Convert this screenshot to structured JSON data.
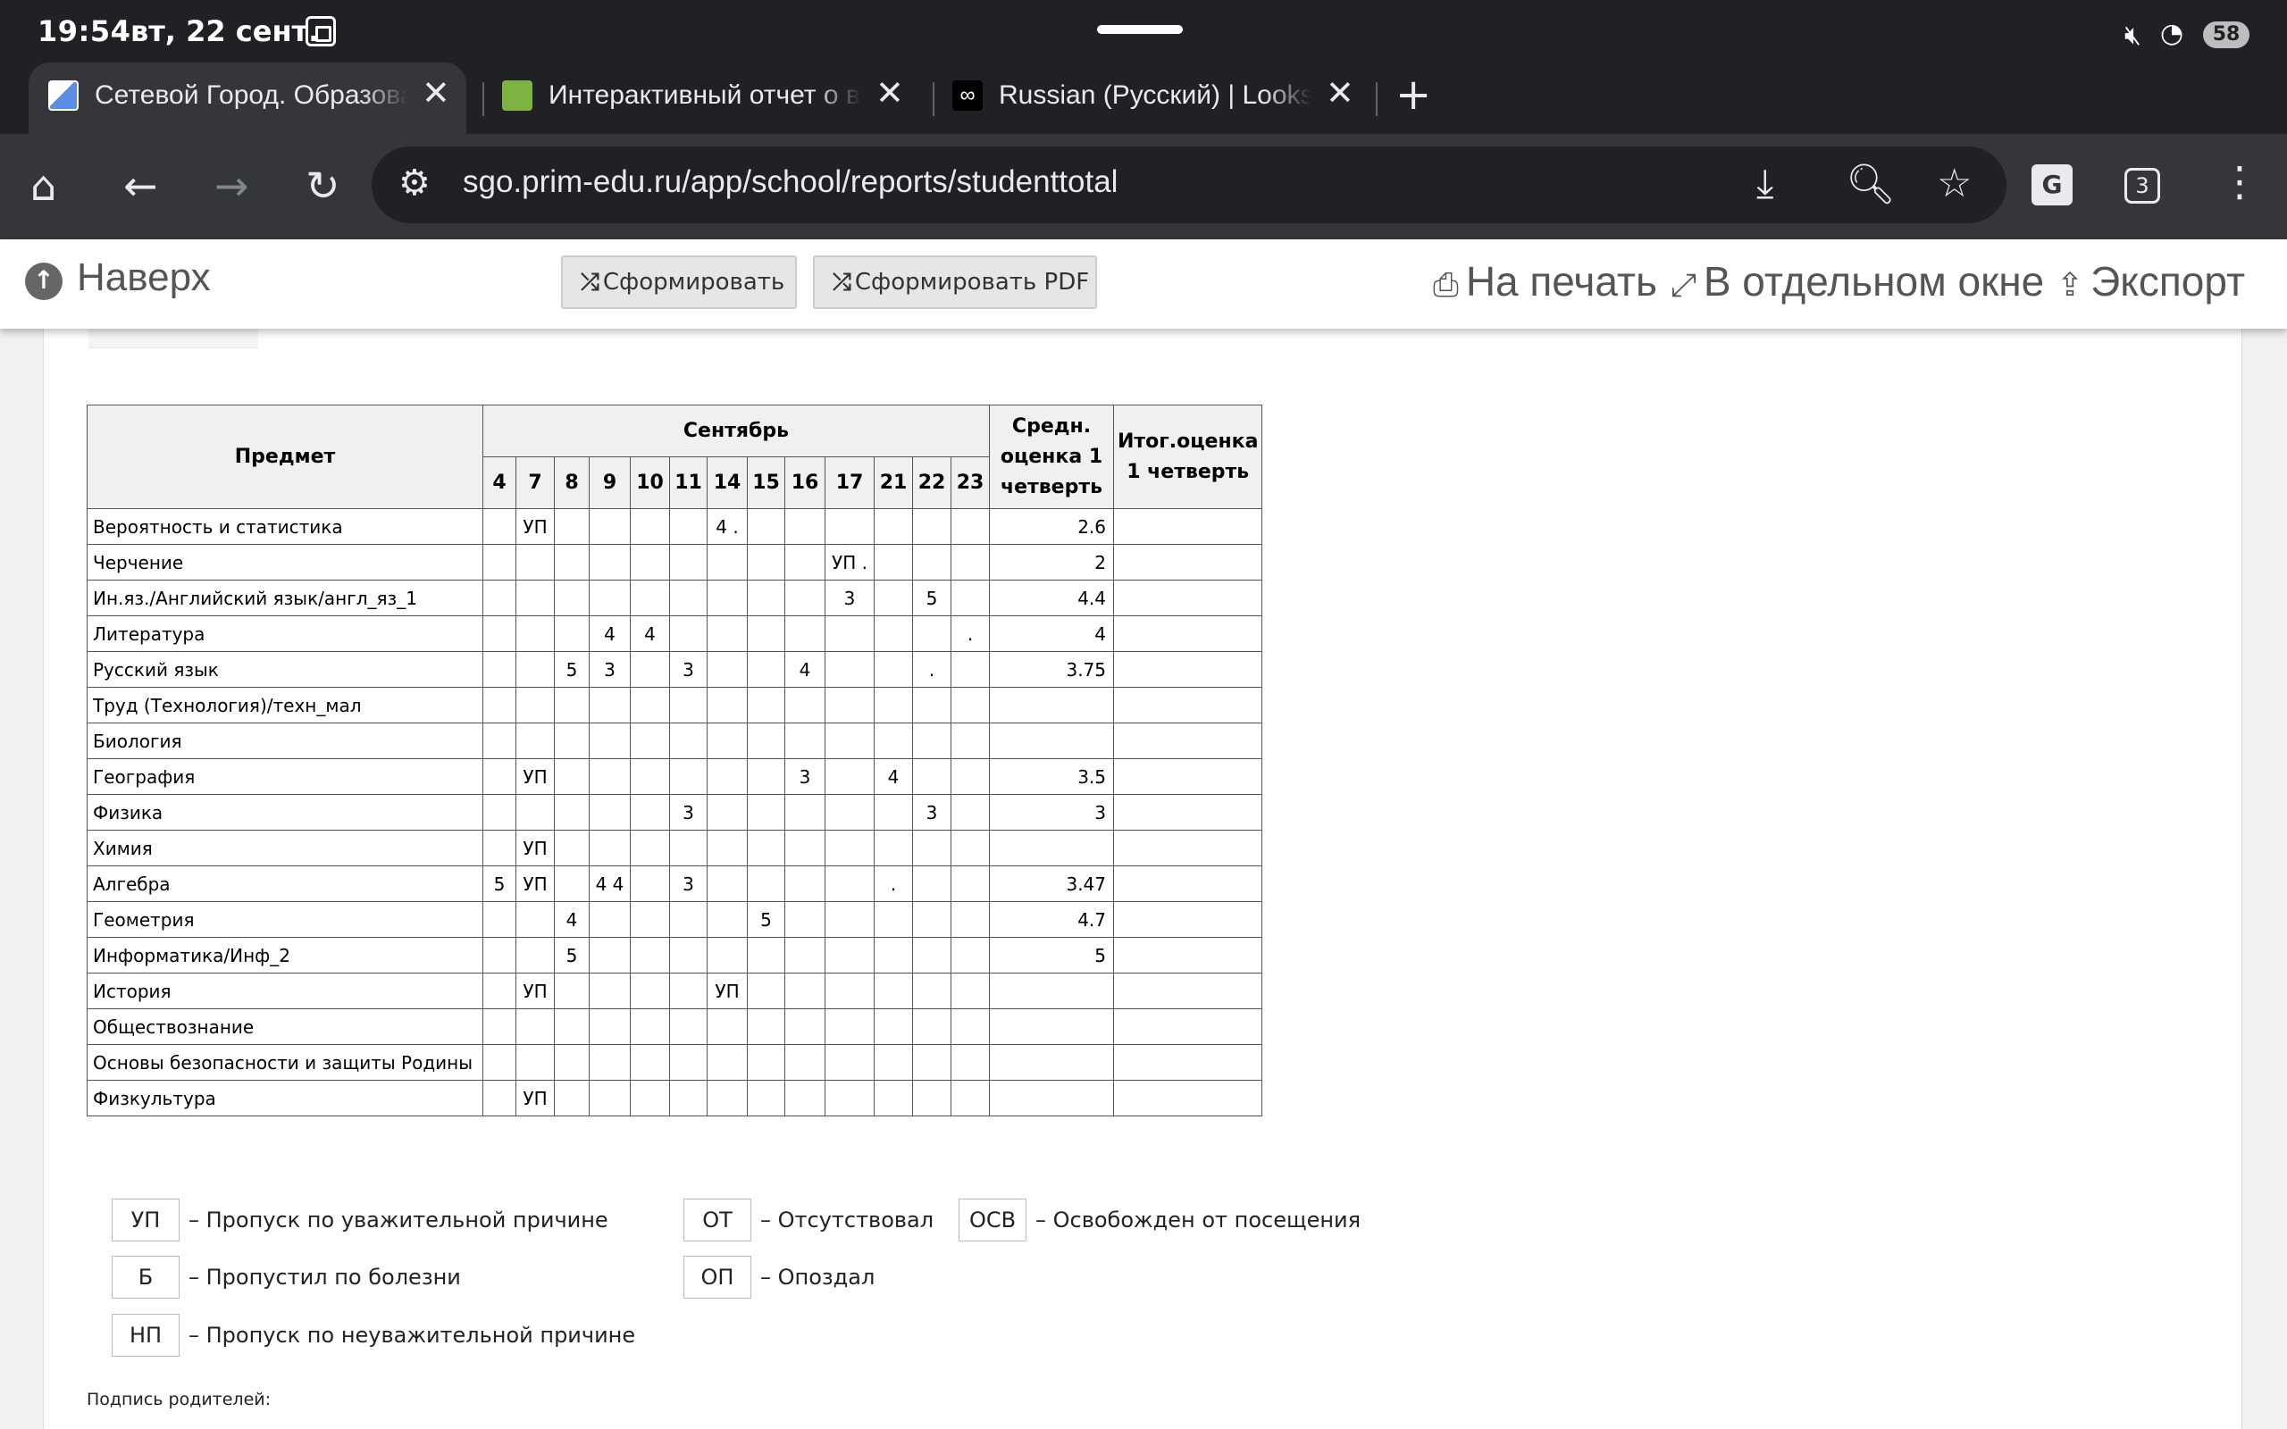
{
  "status": {
    "time": "19:54",
    "date": "вт, 22 сент.",
    "battery": "58"
  },
  "tabs": [
    {
      "title": "Сетевой Город. Образование",
      "fav": "#5a8ee6"
    },
    {
      "title": "Интерактивный отчет о выполнении",
      "fav": "#7cb342"
    },
    {
      "title": "Russian (Русский) | Looksmaxxing",
      "fav": "#000000"
    }
  ],
  "url": "sgo.prim-edu.ru/app/school/reports/studenttotal",
  "tab_count": "3",
  "pagebar": {
    "up_label": "Наверх",
    "btn_generate": "Сформировать",
    "btn_generate_pdf": "Сформировать PDF",
    "print": "На печать",
    "separate_window": "В отдельном окне",
    "export": "Экспорт"
  },
  "table": {
    "subject_header": "Предмет",
    "month": "Сентябрь",
    "days": [
      "4",
      "7",
      "8",
      "9",
      "10",
      "11",
      "14",
      "15",
      "16",
      "17",
      "21",
      "22",
      "23"
    ],
    "avg_header": "Средн. оценка 1 четверть",
    "final_header": "Итог.оценка 1 четверть",
    "rows": [
      {
        "subject": "Вероятность и статистика",
        "cells": [
          "",
          "УП",
          "",
          "",
          "",
          "",
          "4 .",
          "",
          "",
          "",
          "",
          "",
          ""
        ],
        "avg": "2.6",
        "final": ""
      },
      {
        "subject": "Черчение",
        "cells": [
          "",
          "",
          "",
          "",
          "",
          "",
          "",
          "",
          "",
          "УП .",
          "",
          "",
          ""
        ],
        "avg": "2",
        "final": ""
      },
      {
        "subject": "Ин.яз./Английский язык/англ_яз_1",
        "cells": [
          "",
          "",
          "",
          "",
          "",
          "",
          "",
          "",
          "",
          "3",
          "",
          "5",
          ""
        ],
        "avg": "4.4",
        "final": ""
      },
      {
        "subject": "Литература",
        "cells": [
          "",
          "",
          "",
          "4",
          "4",
          "",
          "",
          "",
          "",
          "",
          "",
          "",
          "."
        ],
        "avg": "4",
        "final": ""
      },
      {
        "subject": "Русский язык",
        "cells": [
          "",
          "",
          "5",
          "3",
          "",
          "3",
          "",
          "",
          "4",
          "",
          "",
          ".",
          ""
        ],
        "avg": "3.75",
        "final": ""
      },
      {
        "subject": "Труд (Технология)/техн_мал",
        "cells": [
          "",
          "",
          "",
          "",
          "",
          "",
          "",
          "",
          "",
          "",
          "",
          "",
          ""
        ],
        "avg": "",
        "final": ""
      },
      {
        "subject": "Биология",
        "cells": [
          "",
          "",
          "",
          "",
          "",
          "",
          "",
          "",
          "",
          "",
          "",
          "",
          ""
        ],
        "avg": "",
        "final": ""
      },
      {
        "subject": "География",
        "cells": [
          "",
          "УП",
          "",
          "",
          "",
          "",
          "",
          "",
          "3",
          "",
          "4",
          "",
          ""
        ],
        "avg": "3.5",
        "final": ""
      },
      {
        "subject": "Физика",
        "cells": [
          "",
          "",
          "",
          "",
          "",
          "3",
          "",
          "",
          "",
          "",
          "",
          "3",
          ""
        ],
        "avg": "3",
        "final": ""
      },
      {
        "subject": "Химия",
        "cells": [
          "",
          "УП",
          "",
          "",
          "",
          "",
          "",
          "",
          "",
          "",
          "",
          "",
          ""
        ],
        "avg": "",
        "final": ""
      },
      {
        "subject": "Алгебра",
        "cells": [
          "5",
          "УП",
          "",
          "4 4",
          "",
          "3",
          "",
          "",
          "",
          "",
          ".",
          "",
          ""
        ],
        "avg": "3.47",
        "final": ""
      },
      {
        "subject": "Геометрия",
        "cells": [
          "",
          "",
          "4",
          "",
          "",
          "",
          "",
          "5",
          "",
          "",
          "",
          "",
          ""
        ],
        "avg": "4.7",
        "final": ""
      },
      {
        "subject": "Информатика/Инф_2",
        "cells": [
          "",
          "",
          "5",
          "",
          "",
          "",
          "",
          "",
          "",
          "",
          "",
          "",
          ""
        ],
        "avg": "5",
        "final": ""
      },
      {
        "subject": "История",
        "cells": [
          "",
          "УП",
          "",
          "",
          "",
          "",
          "УП",
          "",
          "",
          "",
          "",
          "",
          ""
        ],
        "avg": "",
        "final": ""
      },
      {
        "subject": "Обществознание",
        "cells": [
          "",
          "",
          "",
          "",
          "",
          "",
          "",
          "",
          "",
          "",
          "",
          "",
          ""
        ],
        "avg": "",
        "final": ""
      },
      {
        "subject": "Основы безопасности и защиты Родины",
        "cells": [
          "",
          "",
          "",
          "",
          "",
          "",
          "",
          "",
          "",
          "",
          "",
          "",
          ""
        ],
        "avg": "",
        "final": ""
      },
      {
        "subject": "Физкультура",
        "cells": [
          "",
          "УП",
          "",
          "",
          "",
          "",
          "",
          "",
          "",
          "",
          "",
          "",
          ""
        ],
        "avg": "",
        "final": ""
      }
    ]
  },
  "legend": [
    {
      "code": "УП",
      "desc": "– Пропуск по уважительной причине"
    },
    {
      "code": "Б",
      "desc": "– Пропустил по болезни"
    },
    {
      "code": "НП",
      "desc": "– Пропуск по неуважительной причине"
    },
    {
      "code": "ОТ",
      "desc": "– Отсутствовал"
    },
    {
      "code": "ОП",
      "desc": "– Опоздал"
    },
    {
      "code": "ОСВ",
      "desc": "– Освобожден от посещения"
    }
  ],
  "signature": "Подпись родителей:"
}
